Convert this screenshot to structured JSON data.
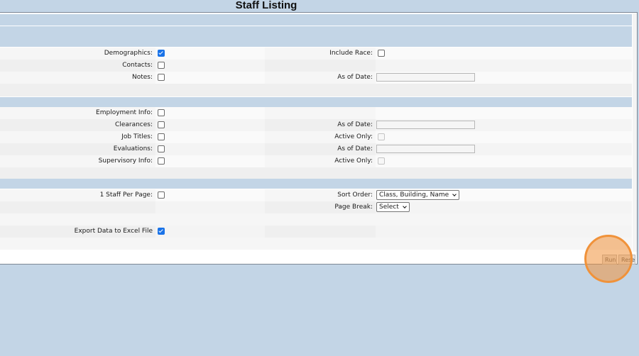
{
  "page": {
    "title": "Staff Listing"
  },
  "demographics_section": {
    "demographics_label": "Demographics:",
    "demographics_checked": true,
    "include_race_label": "Include Race:",
    "include_race_checked": false,
    "contacts_label": "Contacts:",
    "contacts_checked": false,
    "notes_label": "Notes:",
    "notes_checked": false,
    "notes_as_of_date_label": "As of Date:",
    "notes_as_of_date_value": ""
  },
  "employment_section": {
    "employment_info_label": "Employment Info:",
    "clearances_label": "Clearances:",
    "clearances_as_of_date_label": "As of Date:",
    "clearances_as_of_date_value": "",
    "job_titles_label": "Job Titles:",
    "job_titles_active_only_label": "Active Only:",
    "evaluations_label": "Evaluations:",
    "evaluations_as_of_date_label": "As of Date:",
    "evaluations_as_of_date_value": "",
    "supervisory_info_label": "Supervisory Info:",
    "supervisory_active_only_label": "Active Only:"
  },
  "output_section": {
    "staff_per_page_label": "1 Staff Per Page:",
    "staff_per_page_checked": false,
    "sort_order_label": "Sort Order:",
    "sort_order_value": "Class, Building, Name",
    "page_break_label": "Page Break:",
    "page_break_value": "Select",
    "export_label": "Export Data to Excel File",
    "export_checked": true
  },
  "actions": {
    "run_label": "Run",
    "reset_label": "Reset"
  },
  "colors": {
    "background": "#c3d5e6",
    "section_header": "#c3d5e6",
    "checkbox_checked": "#1a73e8",
    "highlight": "#f0923a"
  },
  "icons": {
    "select_caret": "chevron-down-icon"
  }
}
